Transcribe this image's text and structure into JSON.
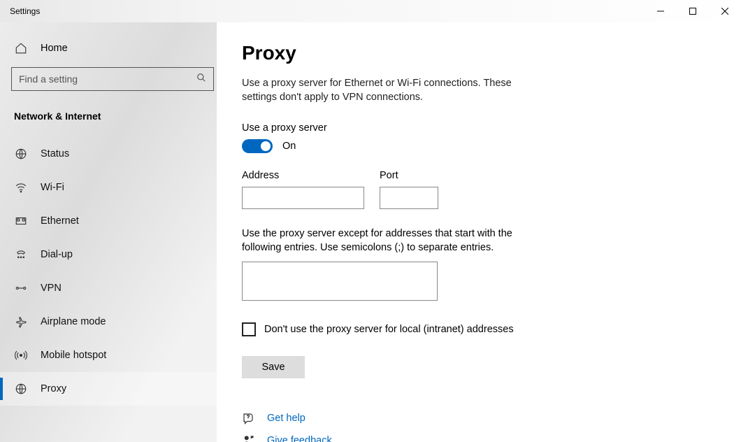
{
  "window": {
    "title": "Settings"
  },
  "sidebar": {
    "home_label": "Home",
    "search_placeholder": "Find a setting",
    "section_title": "Network & Internet",
    "items": [
      {
        "label": "Status"
      },
      {
        "label": "Wi-Fi"
      },
      {
        "label": "Ethernet"
      },
      {
        "label": "Dial-up"
      },
      {
        "label": "VPN"
      },
      {
        "label": "Airplane mode"
      },
      {
        "label": "Mobile hotspot"
      },
      {
        "label": "Proxy"
      }
    ]
  },
  "main": {
    "title": "Proxy",
    "description": "Use a proxy server for Ethernet or Wi-Fi connections. These settings don't apply to VPN connections.",
    "use_proxy_label": "Use a proxy server",
    "toggle_state": "On",
    "address_label": "Address",
    "address_value": "",
    "port_label": "Port",
    "port_value": "",
    "exceptions_desc": "Use the proxy server except for addresses that start with the following entries. Use semicolons (;) to separate entries.",
    "exceptions_value": "",
    "local_checkbox_label": "Don't use the proxy server for local (intranet) addresses",
    "local_checkbox_checked": false,
    "save_label": "Save"
  },
  "footer_links": {
    "get_help": "Get help",
    "give_feedback": "Give feedback"
  }
}
